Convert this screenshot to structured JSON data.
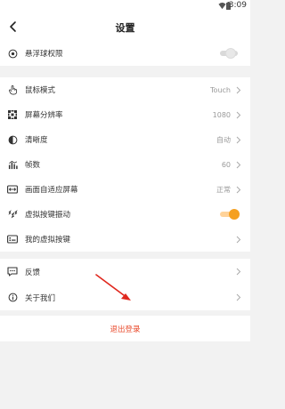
{
  "status_bar": {
    "time": "3:09"
  },
  "header": {
    "title": "设置"
  },
  "floating_ball": {
    "label": "悬浮球权限",
    "enabled": false
  },
  "settings": [
    {
      "label": "鼠标模式",
      "value": "Touch"
    },
    {
      "label": "屏幕分辨率",
      "value": "1080"
    },
    {
      "label": "清晰度",
      "value": "自动"
    },
    {
      "label": "帧数",
      "value": "60"
    },
    {
      "label": "画面自适应屏幕",
      "value": "正常"
    }
  ],
  "vibration": {
    "label": "虚拟按键振动",
    "enabled": true
  },
  "my_keys": {
    "label": "我的虚拟按键"
  },
  "feedback": {
    "label": "反馈"
  },
  "about": {
    "label": "关于我们"
  },
  "logout": {
    "label": "退出登录"
  },
  "colors": {
    "accent": "#f5a020",
    "logout": "#e94b2d",
    "background": "#f2f2f2"
  },
  "icons": [
    "wifi-icon",
    "battery-icon",
    "back-icon",
    "target-icon",
    "touch-hand-icon",
    "resolution-grid-icon",
    "contrast-icon",
    "fps-icon",
    "aspect-ratio-icon",
    "vibration-icon",
    "keyboard-icon",
    "chat-icon",
    "info-icon",
    "chevron-right-icon",
    "arrow-annotation"
  ]
}
